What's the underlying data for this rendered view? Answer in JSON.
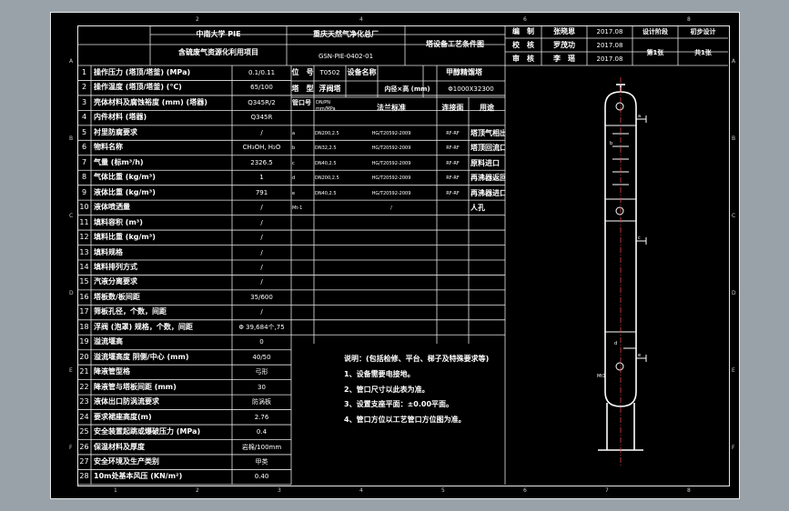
{
  "title_block": {
    "left_top": "中南大学 PIE",
    "left_bottom": "含硫废气资源化利用项目",
    "mid_top": "重庆天然气净化总厂",
    "mid_bottom": "GSN-PIE-0402-01",
    "drawing_name": "塔设备工艺条件图",
    "r1": [
      "编　制",
      "张晓恩",
      "2017.08",
      "设计阶段",
      "初步设计"
    ],
    "r2": [
      "校　核",
      "罗茂功",
      "2017.08"
    ],
    "r3": [
      "审　核",
      "李　瑶",
      "2017.08",
      "第1张",
      "共1张"
    ]
  },
  "rows": [
    {
      "n": "1",
      "label": "操作压力 (塔顶/塔釜) (MPa)",
      "value": "0.1/0.11"
    },
    {
      "n": "2",
      "label": "操作温度 (塔顶/塔釜) (℃)",
      "value": "65/100"
    },
    {
      "n": "3",
      "label": "壳体材料及腐蚀裕度 (mm) (塔器)",
      "value": "Q345R/2"
    },
    {
      "n": "4",
      "label": "内件材料 (塔器)",
      "value": "Q345R"
    },
    {
      "n": "5",
      "label": "衬里防腐要求",
      "value": "/"
    },
    {
      "n": "6",
      "label": "物料名称",
      "value": "CH₃OH, H₂O"
    },
    {
      "n": "7",
      "label": "气量 (标m³/h)",
      "value": "2326.5"
    },
    {
      "n": "8",
      "label": "气体比重 (kg/m³)",
      "value": "1"
    },
    {
      "n": "9",
      "label": "液体比重 (kg/m³)",
      "value": "791"
    },
    {
      "n": "10",
      "label": "液体喷洒量",
      "value": "/"
    },
    {
      "n": "11",
      "label": "填料容积 (m³)",
      "value": "/"
    },
    {
      "n": "12",
      "label": "填料比重 (kg/m³)",
      "value": "/"
    },
    {
      "n": "13",
      "label": "填料规格",
      "value": "/"
    },
    {
      "n": "14",
      "label": "填料排列方式",
      "value": "/"
    },
    {
      "n": "15",
      "label": "汽液分离要求",
      "value": "/"
    },
    {
      "n": "16",
      "label": "塔板数/板间距",
      "value": "35/600"
    },
    {
      "n": "17",
      "label": "筛板孔径，个数，间距",
      "value": "/"
    },
    {
      "n": "18",
      "label": "浮阀 (泡罩) 规格，个数，间距",
      "value": "Φ 39,684个,75"
    },
    {
      "n": "19",
      "label": "溢流堰高",
      "value": "0"
    },
    {
      "n": "20",
      "label": "溢流堰高度 阴侧/中心 (mm)",
      "value": "40/50"
    },
    {
      "n": "21",
      "label": "降液管型格",
      "value": "弓形"
    },
    {
      "n": "22",
      "label": "降液管与塔板间距 (mm)",
      "value": "30"
    },
    {
      "n": "23",
      "label": "液体出口防涡流要求",
      "value": "防涡板"
    },
    {
      "n": "24",
      "label": "要求裙座高度(m)",
      "value": "2.76"
    },
    {
      "n": "25",
      "label": "安全装置起跳或爆破压力 (MPa)",
      "value": "0.4"
    },
    {
      "n": "26",
      "label": "保温材料及厚度",
      "value": "岩棉/100mm"
    },
    {
      "n": "27",
      "label": "安全环境及生产类别",
      "value": "甲类"
    },
    {
      "n": "28",
      "label": "10m处基本风压 (KN/m²)",
      "value": "0.40"
    }
  ],
  "spec": {
    "pos_label": "位　号",
    "pos_value": "T0502",
    "name_label": "设备名称",
    "name_value": "甲醇精馏塔",
    "type_label": "塔　型",
    "type_value": "浮阀塔",
    "dim_label": "内径×高 (mm)",
    "dim_value": "Φ1000X32300"
  },
  "nozzle_header": {
    "no": "管口号",
    "dn": "DN/PN mm/MPa",
    "std": "法兰标准",
    "face": "连接面",
    "use": "用途"
  },
  "nozzles": [
    {
      "no": "a",
      "dn": "DN200,2.5",
      "std": "HG/T20592-2009",
      "face": "RF-RF",
      "use": "塔顶气相出口"
    },
    {
      "no": "b",
      "dn": "DN32,2.5",
      "std": "HG/T20592-2009",
      "face": "RF-RF",
      "use": "塔顶回流口"
    },
    {
      "no": "c",
      "dn": "DN40,2.5",
      "std": "HG/T20592-2009",
      "face": "RF-RF",
      "use": "原料进口"
    },
    {
      "no": "d",
      "dn": "DN200,2.5",
      "std": "HG/T20592-2009",
      "face": "RF-RF",
      "use": "再沸器返回口"
    },
    {
      "no": "e",
      "dn": "DN40,2.5",
      "std": "HG/T20592-2009",
      "face": "RF-RF",
      "use": "再沸器进口"
    },
    {
      "no": "Mt-1",
      "dn": "",
      "std": "/",
      "face": "",
      "use": "人孔"
    }
  ],
  "notes": [
    "说明：(包括检修、平台、梯子及特殊要求等)",
    "1、设备需要电接地。",
    "2、管口尺寸以此表为准。",
    "3、设置支座平面：±0.00平面。",
    "4、管口方位以工艺管口方位图为准。"
  ],
  "tower_labels": [
    "a",
    "b",
    "c",
    "d",
    "e",
    "Mt1"
  ],
  "frame": {
    "cols": [
      "1",
      "2",
      "3",
      "4",
      "5",
      "6",
      "7",
      "8"
    ],
    "rows": [
      "A",
      "B",
      "C",
      "D",
      "E",
      "F"
    ]
  }
}
